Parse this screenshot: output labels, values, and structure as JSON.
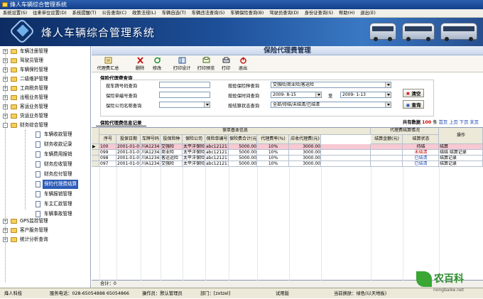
{
  "window": {
    "title": "烽人车辆综合管理系统"
  },
  "menu": [
    "系统设置(S)",
    "往来单位设置(D)",
    "系统提醒(T)",
    "公告查询(C)",
    "政策法规(L)",
    "车辆自选(T)",
    "车辆违法查询(S)",
    "车辆保险查询(B)",
    "驾驶员查询(D)",
    "身份证查询(S)",
    "帮助(H)",
    "退出(E)"
  ],
  "banner": {
    "title": "烽人车辆综合管理系统"
  },
  "sidebar": {
    "items": [
      {
        "label": "车辆注册管理",
        "kind": "folder",
        "expand": "+",
        "level": 0
      },
      {
        "label": "驾驶员管理",
        "kind": "folder",
        "expand": "+",
        "level": 0
      },
      {
        "label": "车辆保险管理",
        "kind": "folder",
        "expand": "+",
        "level": 0
      },
      {
        "label": "二级维护管理",
        "kind": "folder",
        "expand": "+",
        "level": 0
      },
      {
        "label": "工商税务管理",
        "kind": "folder",
        "expand": "+",
        "level": 0
      },
      {
        "label": "出租业务管理",
        "kind": "folder",
        "expand": "+",
        "level": 0
      },
      {
        "label": "客运业务管理",
        "kind": "folder",
        "expand": "+",
        "level": 0
      },
      {
        "label": "货运业务管理",
        "kind": "folder",
        "expand": "+",
        "level": 0
      },
      {
        "label": "财务综合管理",
        "kind": "folder",
        "expand": "-",
        "level": 0
      },
      {
        "label": "车辆收款管理",
        "kind": "doc",
        "expand": "",
        "level": 1
      },
      {
        "label": "财务收款记录",
        "kind": "doc",
        "expand": "",
        "level": 1
      },
      {
        "label": "车辆费用报销",
        "kind": "doc",
        "expand": "",
        "level": 1
      },
      {
        "label": "财务应收管理",
        "kind": "doc",
        "expand": "",
        "level": 1
      },
      {
        "label": "财务应付管理",
        "kind": "doc",
        "expand": "",
        "level": 1
      },
      {
        "label": "保险代理费结算",
        "kind": "doc",
        "expand": "",
        "level": 1,
        "selected": true
      },
      {
        "label": "车辆报销管理",
        "kind": "doc",
        "expand": "",
        "level": 1
      },
      {
        "label": "车主汇款管理",
        "kind": "doc",
        "expand": "",
        "level": 1
      },
      {
        "label": "车辆事故管理",
        "kind": "doc",
        "expand": "",
        "level": 1
      },
      {
        "label": "GPS监控管理",
        "kind": "folder",
        "expand": "+",
        "level": 0
      },
      {
        "label": "客户服务管理",
        "kind": "folder",
        "expand": "+",
        "level": 0
      },
      {
        "label": "统计分析查询",
        "kind": "folder",
        "expand": "+",
        "level": 0
      }
    ]
  },
  "page": {
    "title": "保险代理费管理"
  },
  "toolbar": [
    {
      "label": "代理费汇总",
      "icon": "summary-icon"
    },
    {
      "label": "删除",
      "icon": "delete-icon"
    },
    {
      "label": "修改",
      "icon": "edit-icon"
    },
    {
      "label": "打印设计",
      "icon": "print-design-icon"
    },
    {
      "label": "打印预览",
      "icon": "print-preview-icon"
    },
    {
      "label": "打印",
      "icon": "print-icon"
    },
    {
      "label": "退出",
      "icon": "exit-icon"
    }
  ],
  "query": {
    "title": "保险代理费查询",
    "plate_label": "按车牌号码查询",
    "type_label": "按投保险种查询",
    "type_value": "交强险/商业险/客运险",
    "policy_label": "保险单编号查询",
    "date_label": "按投保时间查询",
    "date_from": "2009- 8-15",
    "date_sep": "至",
    "date_to": "2009- 1-13",
    "company_label": "保险公司名称查询",
    "status_label": "按结算状态查询",
    "status_value": "全部/待结/未结清/已结清",
    "clear_label": "清空",
    "search_label": "查询"
  },
  "list": {
    "tab": "保险代理费信息记录",
    "count_label": "共有数据",
    "count": "100",
    "count_unit": "条",
    "first": "首页",
    "prev": "上页",
    "next": "下页",
    "last": "末页",
    "group_basic": "保单基本信息",
    "group_settle": "代理费结算情况",
    "headers": [
      "序号",
      "投保日期",
      "车牌号码",
      "投保险种",
      "保险公司",
      "保险单编号",
      "保险费合计(元)",
      "代理费率(%)",
      "应收代理费(元)",
      "结算金额(元)",
      "结算状态",
      "操作"
    ],
    "rows": [
      [
        "100",
        "2001-01-01",
        "川A12345",
        "交强险",
        "太平洋保险",
        "abc121211",
        "5000.00",
        "10%",
        "3000.00",
        "",
        "待结",
        "结算"
      ],
      [
        "099",
        "2001-01-01",
        "川A12345",
        "商业险",
        "太平洋保险",
        "abc121211",
        "5000.00",
        "10%",
        "3000.00",
        "",
        "未结清",
        "结结  结算记录"
      ],
      [
        "098",
        "2001-01-01",
        "川A12345",
        "客运运险",
        "太平洋保险",
        "abc121211",
        "5000.00",
        "10%",
        "3000.00",
        "",
        "已结清",
        "结算记录"
      ],
      [
        "097",
        "2001-01-01",
        "川A12345",
        "交强险",
        "太平洋保险",
        "abc121211",
        "5000.00",
        "10%",
        "3000.00",
        "",
        "已结清",
        "结算记录"
      ]
    ],
    "footer": "合计：0"
  },
  "status": {
    "company": "烽人科技",
    "phone": "服务电话：028-65054888 65054866",
    "operator": "操作员：默认管理员",
    "dept": "部门：[zxtzel]",
    "version": "试用版",
    "skin": "当前换肤：绿色(以天地板)"
  },
  "watermark": {
    "text": "农百科",
    "url": "nongbaike.net"
  },
  "colors": {
    "title_blue": "#123e8a",
    "selected_row": "#f7c9d2",
    "status_red": "#c00000",
    "link_blue": "#1a46b4"
  }
}
